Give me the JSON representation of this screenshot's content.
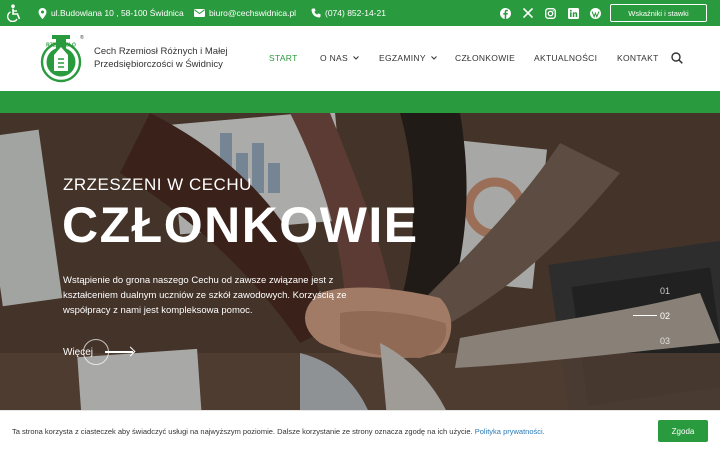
{
  "topbar": {
    "address": "ul.Budowlana 10 , 58-100 Świdnica",
    "email": "biuro@cechswidnica.pl",
    "phone": "(074) 852-14-21",
    "rates_button": "Wskaźniki i stawki",
    "social_icons": [
      "facebook-icon",
      "x-icon",
      "instagram-icon",
      "linkedin-icon",
      "wordpress-icon"
    ]
  },
  "header": {
    "logo_text": "RZEMIOSŁO",
    "brand": "Cech Rzemiosł Różnych i Małej Przedsiębiorczości w Świdnicy",
    "nav": [
      "START",
      "O NAS",
      "EGZAMINY",
      "CZŁONKOWIE",
      "AKTUALNOŚCI",
      "KONTAKT"
    ]
  },
  "hero": {
    "subtitle": "ZRZESZENI W CECHU",
    "title": "CZŁONKOWIE",
    "description": "Wstąpienie do grona naszego Cechu od zawsze związane jest z kształceniem dualnym uczniów ze szkół zawodowych. Korzyścią ze współpracy z nami jest kompleksowa pomoc.",
    "more": "Więcej",
    "slides": [
      "01",
      "02",
      "03"
    ]
  },
  "cookie": {
    "text": "Ta strona korzysta z ciasteczek aby świadczyć usługi na najwyższym poziomie. Dalsze korzystanie ze strony oznacza zgodę na ich użycie.",
    "link": "Polityka prywatności.",
    "agree": "Zgoda"
  },
  "colors": {
    "brand_green": "#2a9a3e",
    "link_blue": "#2a7ab8"
  }
}
